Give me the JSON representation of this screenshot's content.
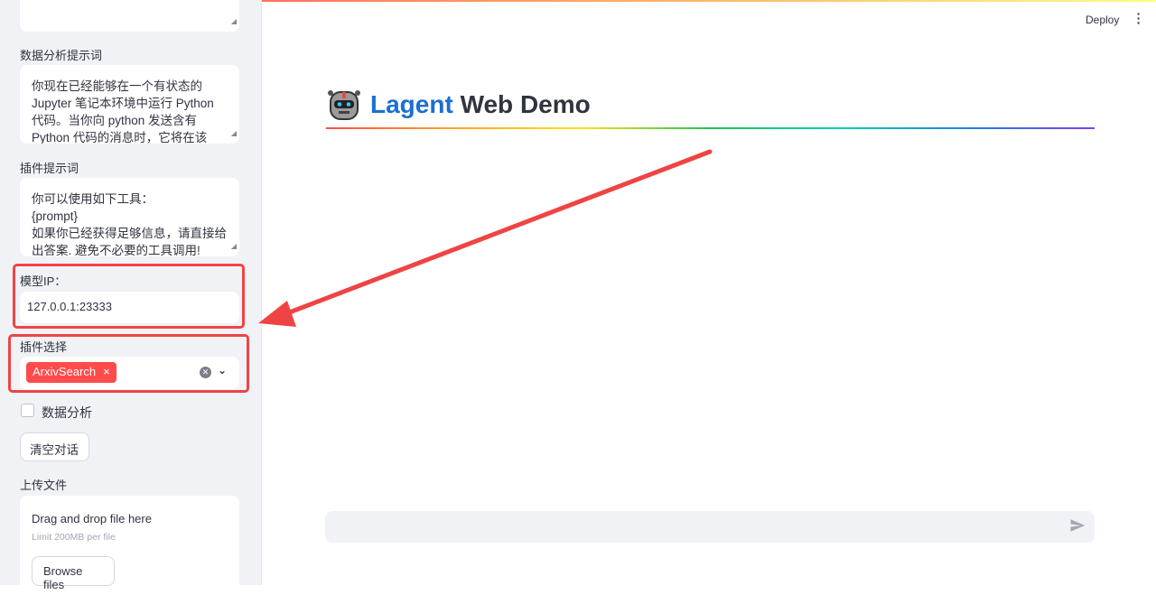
{
  "header": {
    "deploy_label": "Deploy",
    "menu_icon": "more-vertical-icon"
  },
  "sidebar": {
    "data_prompt": {
      "label": "数据分析提示词",
      "value": "你现在已经能够在一个有状态的 Jupyter 笔记本环境中运行 Python 代码。当你向 python 发送含有 Python 代码的消息时，它将在该"
    },
    "plugin_prompt": {
      "label": "插件提示词",
      "lines": [
        "你可以使用如下工具：",
        "{prompt}",
        "如果你已经获得足够信息，请直接给出答案. 避免不必要的工具调用!"
      ]
    },
    "model_ip": {
      "label": "模型IP：",
      "value": "127.0.0.1:23333"
    },
    "plugin_select": {
      "label": "插件选择",
      "selected": [
        "ArxivSearch"
      ]
    },
    "data_analysis_checkbox": {
      "label": "数据分析",
      "checked": false
    },
    "clear_button": "清空对话",
    "upload": {
      "label": "上传文件",
      "drag_text": "Drag and drop file here",
      "limit": "Limit 200MB per file",
      "browse": "Browse files"
    }
  },
  "main": {
    "title_brand": "Lagent",
    "title_rest": "Web Demo",
    "brand_color": "#1c6fd1",
    "chat_placeholder": ""
  },
  "annotation_color": "#ef4444"
}
